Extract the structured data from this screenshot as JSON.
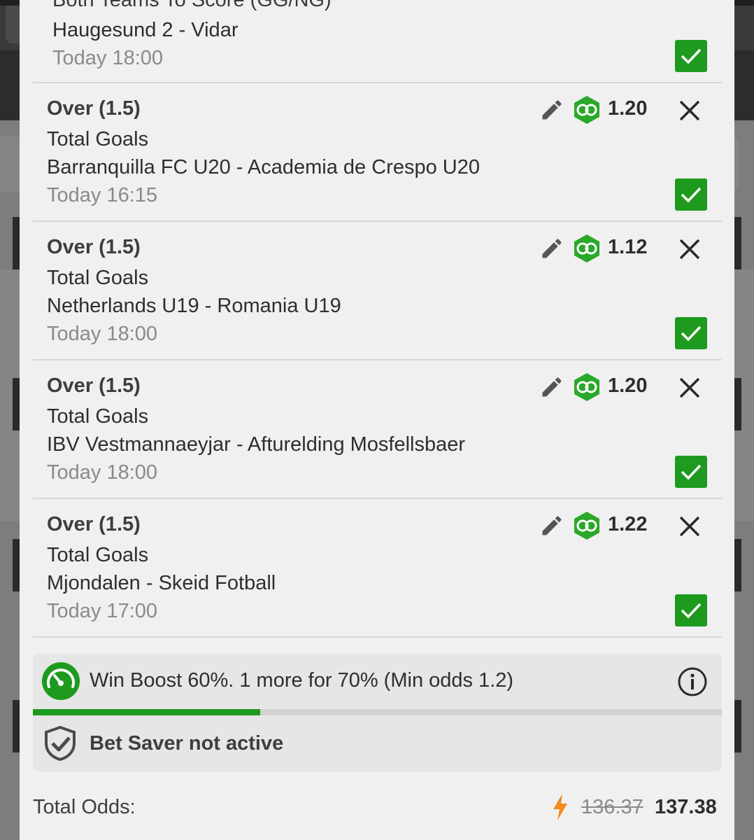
{
  "colors": {
    "accent": "#1e9a1e",
    "boost": "#f28c1b",
    "background": "#f0f0f0"
  },
  "top_selection": {
    "market_partial": "Both Teams To Score (GG/NG)",
    "match": "Haugesund 2 - Vidar",
    "time": "Today 18:00"
  },
  "selections": [
    {
      "market": "Over (1.5)",
      "type": "Total Goals",
      "match": "Barranquilla FC U20 - Academia de Crespo U20",
      "time": "Today 16:15",
      "odds": "1.20"
    },
    {
      "market": "Over (1.5)",
      "type": "Total Goals",
      "match": "Netherlands U19 - Romania U19",
      "time": "Today 18:00",
      "odds": "1.12"
    },
    {
      "market": "Over (1.5)",
      "type": "Total Goals",
      "match": "IBV Vestmannaeyjar - Afturelding Mosfellsbaer",
      "time": "Today 18:00",
      "odds": "1.20"
    },
    {
      "market": "Over (1.5)",
      "type": "Total Goals",
      "match": "Mjondalen - Skeid Fotball",
      "time": "Today 17:00",
      "odds": "1.22"
    }
  ],
  "win_boost": {
    "text": "Win Boost 60%. 1 more for 70% (Min odds 1.2)",
    "progress": 0.33
  },
  "bet_saver": {
    "text": "Bet Saver not active"
  },
  "totals": {
    "label": "Total Odds:",
    "old_odds": "136.37",
    "new_odds": "137.38"
  }
}
